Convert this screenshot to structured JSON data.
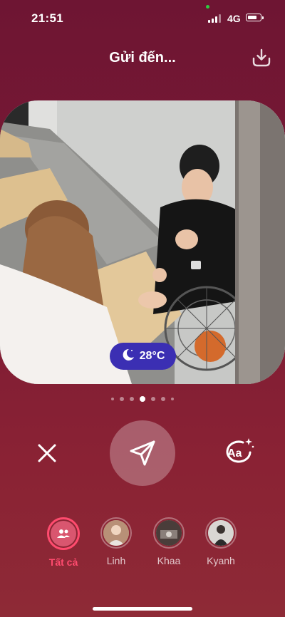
{
  "status": {
    "time": "21:51",
    "network": "4G"
  },
  "header": {
    "title": "Gửi đến...",
    "download_icon": "download-icon"
  },
  "photo": {
    "weather_temp": "28°C",
    "weather_icon": "moon-cloud-icon",
    "page_count": 7,
    "active_page": 4
  },
  "actions": {
    "close_icon": "close-icon",
    "send_icon": "send-icon",
    "text_icon": "text-aa-icon",
    "text_label": "Aa"
  },
  "friends": [
    {
      "label": "Tất cả",
      "icon": "group-icon",
      "selected": true
    },
    {
      "label": "Linh"
    },
    {
      "label": "Khaa"
    },
    {
      "label": "Kyanh"
    }
  ],
  "colors": {
    "accent": "#ff4b6e",
    "weather_chip": "#3b2fb3"
  }
}
